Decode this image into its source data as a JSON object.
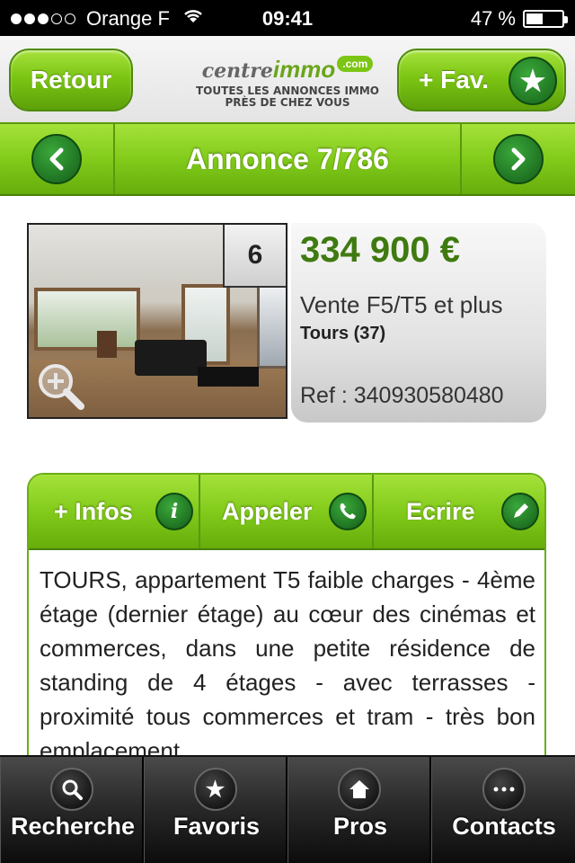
{
  "status_bar": {
    "carrier": "Orange F",
    "time": "09:41",
    "battery": "47 %",
    "battery_level": 0.47,
    "signal_bars": 3
  },
  "header": {
    "back_label": "Retour",
    "fav_label": "+ Fav.",
    "fav_icon": "star-icon",
    "logo": {
      "part1": "centre",
      "part2": "immo",
      "part3": ".com",
      "tagline_line1": "TOUTES LES ANNONCES IMMO",
      "tagline_line2": "PRÈS DE CHEZ VOUS"
    }
  },
  "nav": {
    "title": "Annonce 7/786",
    "prev_icon": "chevron-left-icon",
    "next_icon": "chevron-right-icon"
  },
  "listing": {
    "photo_count": "6",
    "price": "334 900 €",
    "type": "Vente F5/T5 et plus",
    "city": "Tours (37)",
    "reference": "Ref : 340930580480",
    "zoom_icon": "zoom-in-icon"
  },
  "actions": {
    "tabs": [
      {
        "label": "+ Infos",
        "icon": "info-icon"
      },
      {
        "label": "Appeler",
        "icon": "phone-icon"
      },
      {
        "label": "Ecrire",
        "icon": "pencil-icon"
      }
    ],
    "description": "TOURS, appartement T5 faible charges - 4ème étage (dernier étage) au cœur des cinémas et commerces, dans une petite résidence de standing de 4 étages - avec terrasses - proximité tous commerces et tram - très bon emplacement"
  },
  "tab_bar": {
    "items": [
      {
        "label": "Recherche",
        "icon": "search-icon"
      },
      {
        "label": "Favoris",
        "icon": "star-icon"
      },
      {
        "label": "Pros",
        "icon": "home-icon"
      },
      {
        "label": "Contacts",
        "icon": "ellipsis-icon"
      }
    ]
  },
  "colors": {
    "accent_green": "#7cc514",
    "dark_green": "#1a6b1e",
    "price_green": "#3f7a10"
  }
}
